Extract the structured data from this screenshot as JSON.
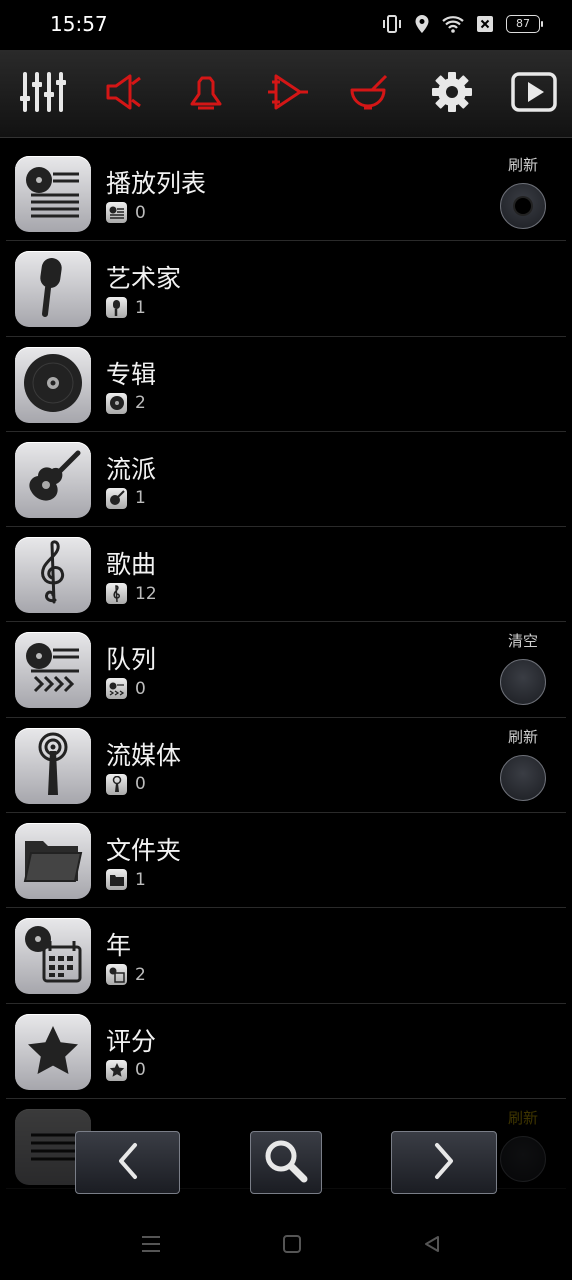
{
  "status": {
    "time": "15:57",
    "battery": "87"
  },
  "toolbar": {
    "icons": [
      "equalizer-icon",
      "speaker-icon",
      "bell-icon",
      "amplifier-icon",
      "mortar-icon",
      "gear-icon",
      "play-icon"
    ]
  },
  "list": {
    "items": [
      {
        "title": "播放列表",
        "count": "0",
        "icon": "playlist-icon",
        "action": "刷新",
        "knob_on": true
      },
      {
        "title": "艺术家",
        "count": "1",
        "icon": "microphone-icon",
        "action": ""
      },
      {
        "title": "专辑",
        "count": "2",
        "icon": "disc-icon",
        "action": ""
      },
      {
        "title": "流派",
        "count": "1",
        "icon": "guitar-icon",
        "action": ""
      },
      {
        "title": "歌曲",
        "count": "12",
        "icon": "treble-clef-icon",
        "action": ""
      },
      {
        "title": "队列",
        "count": "0",
        "icon": "queue-icon",
        "action": "清空"
      },
      {
        "title": "流媒体",
        "count": "0",
        "icon": "antenna-icon",
        "action": "刷新"
      },
      {
        "title": "文件夹",
        "count": "1",
        "icon": "folder-icon",
        "action": ""
      },
      {
        "title": "年",
        "count": "2",
        "icon": "calendar-icon",
        "action": ""
      },
      {
        "title": "评分",
        "count": "0",
        "icon": "star-icon",
        "action": ""
      }
    ],
    "partial_action": "刷新"
  },
  "colors": {
    "accent_red": "#d41616",
    "partial_label": "#f5d000"
  }
}
